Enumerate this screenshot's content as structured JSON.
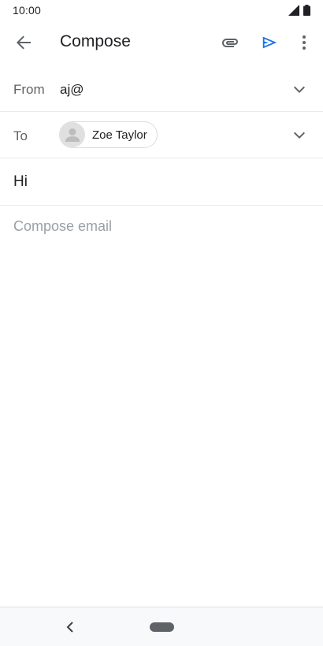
{
  "status_bar": {
    "time": "10:00",
    "icons": [
      "signal-icon",
      "battery-icon"
    ]
  },
  "app_bar": {
    "title": "Compose",
    "icons": [
      "back-arrow-icon",
      "attachment-icon",
      "send-icon",
      "more-vert-icon"
    ],
    "accent_color": "#1a73e8"
  },
  "from": {
    "label": "From",
    "value": "aj@"
  },
  "to": {
    "label": "To",
    "recipients": [
      {
        "name": "Zoe Taylor",
        "avatar_icon": "person-icon"
      }
    ]
  },
  "subject": {
    "value": "Hi"
  },
  "body": {
    "placeholder": "Compose email",
    "value": ""
  },
  "nav_bar": {
    "icons": [
      "nav-back-icon",
      "home-pill"
    ]
  }
}
